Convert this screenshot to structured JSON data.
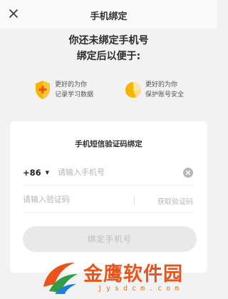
{
  "header": {
    "title": "手机绑定",
    "close_icon": "close-icon"
  },
  "headline": {
    "line1": "你还未绑定手机号",
    "line2": "绑定后以便于:"
  },
  "benefits": [
    {
      "icon": "shield-plus-icon",
      "line1": "更好的为你",
      "line2": "记录学习数据",
      "color": "#f5b400"
    },
    {
      "icon": "pie-chart-icon",
      "line1": "更好的为你",
      "line2": "保护账号安全",
      "color": "#f5b400"
    }
  ],
  "form": {
    "title": "手机短信验证码绑定",
    "country_code": "+86",
    "phone_placeholder": "请输入手机号",
    "phone_value": "",
    "code_placeholder": "请输入验证码",
    "code_value": "",
    "get_code_label": "获取验证码",
    "submit_label": "绑定手机号"
  },
  "watermark": {
    "brand": "金鹰软件园",
    "url": "jysdcm.com"
  },
  "colors": {
    "accent": "#f5b400",
    "background": "#f2f2f2",
    "button_disabled": "#e9e9e9",
    "watermark": "#e8541a"
  }
}
